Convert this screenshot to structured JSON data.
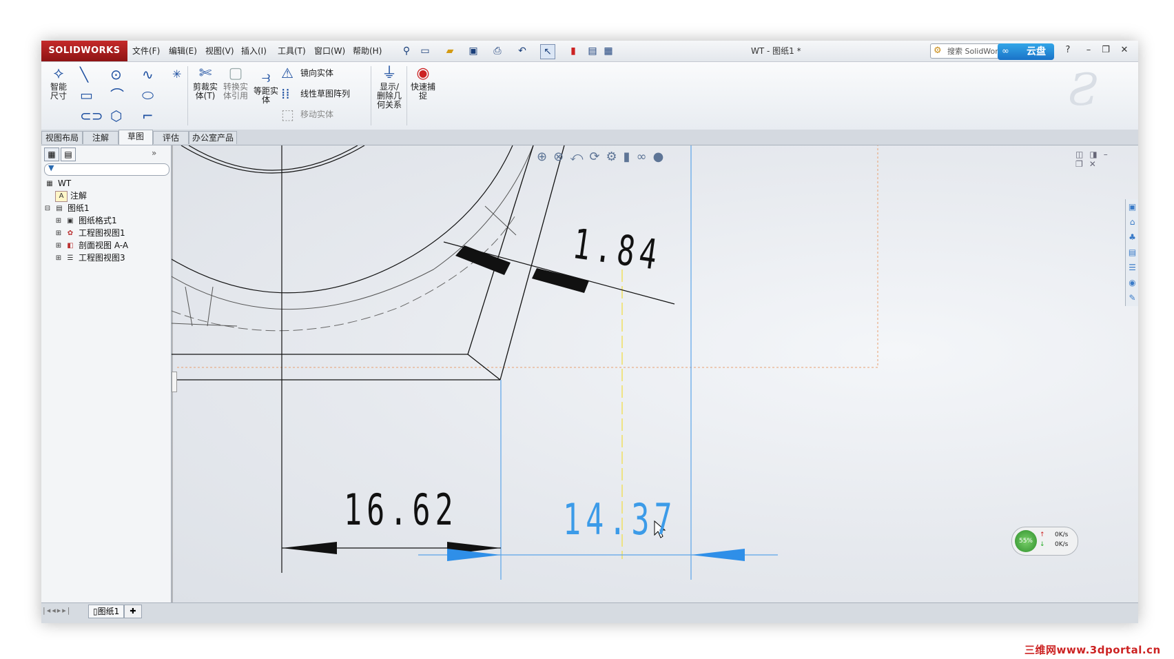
{
  "app": {
    "brand": "SOLIDWORKS",
    "doc_title": "WT - 图纸1 *"
  },
  "menu": [
    "文件(F)",
    "编辑(E)",
    "视图(V)",
    "插入(I)",
    "工具(T)",
    "窗口(W)",
    "帮助(H)"
  ],
  "search": {
    "placeholder": "搜索 SolidWork",
    "cloud_label": "云盘"
  },
  "ribbon": {
    "smart_dim": "智能尺寸",
    "trim": "剪裁实体(T)",
    "convert": "转换实体引用",
    "offset": "等距实体",
    "mirror": "镜向实体",
    "linear_pattern": "线性草图阵列",
    "move": "移动实体",
    "display_relations": "显示/删除几何关系",
    "quick_snap": "快速捕捉"
  },
  "tabs": [
    "视图布局",
    "注解",
    "草图",
    "评估",
    "办公室产品"
  ],
  "active_tab": "草图",
  "tree": {
    "root": "WT",
    "annotations": "注解",
    "sheet": "图纸1",
    "children": [
      "图纸格式1",
      "工程图视图1",
      "剖面视图 A-A",
      "工程图视图3"
    ]
  },
  "dimensions": {
    "d1": "1.84",
    "d2": "16.62",
    "d3": "14.37"
  },
  "status": {
    "sheet_tab": "图纸1"
  },
  "netmon": {
    "percent": "55%",
    "up": "0K/s",
    "down": "0K/s"
  },
  "watermark": "三维网www.3dportal.cn",
  "colors": {
    "accent": "#1d4fa0",
    "dimension_active": "#3c9be8",
    "brand_red": "#b51f1f"
  }
}
